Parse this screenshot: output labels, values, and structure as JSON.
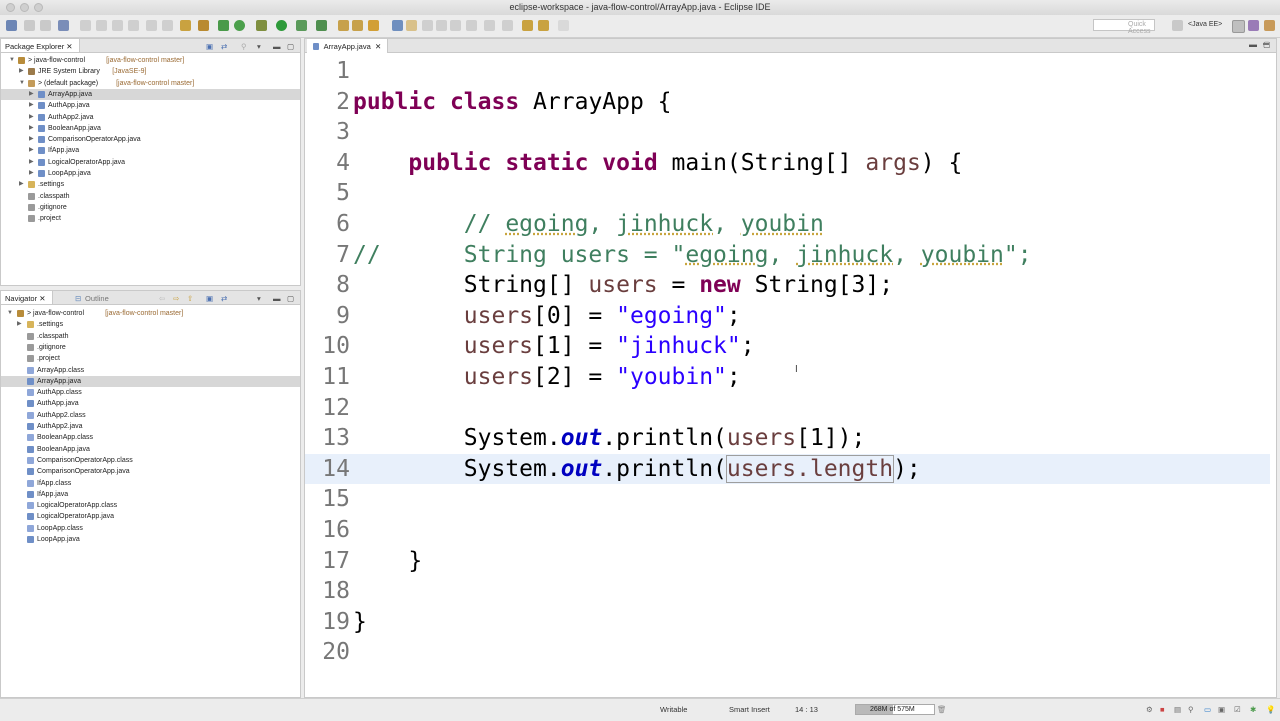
{
  "window": {
    "title": "eclipse-workspace - java-flow-control/ArrayApp.java - Eclipse IDE"
  },
  "toolbar": {
    "quick_access_placeholder": "Quick Access",
    "perspective": "<Java EE>"
  },
  "package_explorer": {
    "tab_label": "Package Explorer",
    "items": [
      {
        "label": "> java-flow-control",
        "decoration": "[java-flow-control master]",
        "icon": "project-icon"
      },
      {
        "label": "JRE System Library",
        "decoration": "[JavaSE-9]",
        "icon": "library-icon"
      },
      {
        "label": "> (default package)",
        "decoration": "[java-flow-control master]",
        "icon": "package-icon"
      },
      {
        "label": "ArrayApp.java",
        "decoration": "",
        "icon": "java-file-icon"
      },
      {
        "label": "AuthApp.java",
        "decoration": "",
        "icon": "java-file-icon"
      },
      {
        "label": "AuthApp2.java",
        "decoration": "",
        "icon": "java-file-icon"
      },
      {
        "label": "BooleanApp.java",
        "decoration": "",
        "icon": "java-file-icon"
      },
      {
        "label": "ComparisonOperatorApp.java",
        "decoration": "",
        "icon": "java-file-icon"
      },
      {
        "label": "IfApp.java",
        "decoration": "",
        "icon": "java-file-icon"
      },
      {
        "label": "LogicalOperatorApp.java",
        "decoration": "",
        "icon": "java-file-icon"
      },
      {
        "label": "LoopApp.java",
        "decoration": "",
        "icon": "java-file-icon"
      },
      {
        "label": ".settings",
        "decoration": "",
        "icon": "folder-icon"
      },
      {
        "label": ".classpath",
        "decoration": "",
        "icon": "file-icon"
      },
      {
        "label": ".gitignore",
        "decoration": "",
        "icon": "file-icon"
      },
      {
        "label": ".project",
        "decoration": "",
        "icon": "file-icon"
      }
    ]
  },
  "navigator": {
    "tab_label": "Navigator",
    "outline_label": "Outline",
    "items": [
      {
        "label": "> java-flow-control",
        "decoration": "[java-flow-control master]"
      },
      {
        "label": ".settings",
        "decoration": ""
      },
      {
        "label": ".classpath",
        "decoration": ""
      },
      {
        "label": ".gitignore",
        "decoration": ""
      },
      {
        "label": ".project",
        "decoration": ""
      },
      {
        "label": "ArrayApp.class",
        "decoration": ""
      },
      {
        "label": "ArrayApp.java",
        "decoration": ""
      },
      {
        "label": "AuthApp.class",
        "decoration": ""
      },
      {
        "label": "AuthApp.java",
        "decoration": ""
      },
      {
        "label": "AuthApp2.class",
        "decoration": ""
      },
      {
        "label": "AuthApp2.java",
        "decoration": ""
      },
      {
        "label": "BooleanApp.class",
        "decoration": ""
      },
      {
        "label": "BooleanApp.java",
        "decoration": ""
      },
      {
        "label": "ComparisonOperatorApp.class",
        "decoration": ""
      },
      {
        "label": "ComparisonOperatorApp.java",
        "decoration": ""
      },
      {
        "label": "IfApp.class",
        "decoration": ""
      },
      {
        "label": "IfApp.java",
        "decoration": ""
      },
      {
        "label": "LogicalOperatorApp.class",
        "decoration": ""
      },
      {
        "label": "LogicalOperatorApp.java",
        "decoration": ""
      },
      {
        "label": "LoopApp.class",
        "decoration": ""
      },
      {
        "label": "LoopApp.java",
        "decoration": ""
      }
    ]
  },
  "editor": {
    "tab_label": "ArrayApp.java",
    "lines": [
      {
        "n": "1",
        "tokens": []
      },
      {
        "n": "2",
        "tokens": [
          {
            "t": "public",
            "c": "kw"
          },
          {
            "t": " "
          },
          {
            "t": "class",
            "c": "kw"
          },
          {
            "t": " ArrayApp {"
          }
        ]
      },
      {
        "n": "3",
        "tokens": []
      },
      {
        "n": "4",
        "tokens": [
          {
            "t": "    "
          },
          {
            "t": "public",
            "c": "kw"
          },
          {
            "t": " "
          },
          {
            "t": "static",
            "c": "kw"
          },
          {
            "t": " "
          },
          {
            "t": "void",
            "c": "kw"
          },
          {
            "t": " main(String[] "
          },
          {
            "t": "args",
            "c": "var"
          },
          {
            "t": ") {"
          }
        ]
      },
      {
        "n": "5",
        "tokens": []
      },
      {
        "n": "6",
        "tokens": [
          {
            "t": "        "
          },
          {
            "t": "// ",
            "c": "cm"
          },
          {
            "t": "egoing",
            "c": "cm sq"
          },
          {
            "t": ", ",
            "c": "cm"
          },
          {
            "t": "jinhuck",
            "c": "cm sq"
          },
          {
            "t": ", ",
            "c": "cm"
          },
          {
            "t": "youbin",
            "c": "cm sq"
          }
        ]
      },
      {
        "n": "7",
        "tokens": [
          {
            "t": "//      String users = \"",
            "c": "cm"
          },
          {
            "t": "egoing",
            "c": "cm sq"
          },
          {
            "t": ", ",
            "c": "cm"
          },
          {
            "t": "jinhuck",
            "c": "cm sq"
          },
          {
            "t": ", ",
            "c": "cm"
          },
          {
            "t": "youbin",
            "c": "cm sq"
          },
          {
            "t": "\";",
            "c": "cm"
          }
        ]
      },
      {
        "n": "8",
        "tokens": [
          {
            "t": "        String[] "
          },
          {
            "t": "users",
            "c": "var"
          },
          {
            "t": " = "
          },
          {
            "t": "new",
            "c": "kw"
          },
          {
            "t": " String[3];"
          }
        ]
      },
      {
        "n": "9",
        "tokens": [
          {
            "t": "        "
          },
          {
            "t": "users",
            "c": "var"
          },
          {
            "t": "[0] = "
          },
          {
            "t": "\"egoing\"",
            "c": "st"
          },
          {
            "t": ";"
          }
        ]
      },
      {
        "n": "10",
        "tokens": [
          {
            "t": "        "
          },
          {
            "t": "users",
            "c": "var"
          },
          {
            "t": "[1] = "
          },
          {
            "t": "\"jinhuck\"",
            "c": "st"
          },
          {
            "t": ";"
          }
        ]
      },
      {
        "n": "11",
        "tokens": [
          {
            "t": "        "
          },
          {
            "t": "users",
            "c": "var"
          },
          {
            "t": "[2] = "
          },
          {
            "t": "\"youbin\"",
            "c": "st"
          },
          {
            "t": ";"
          }
        ]
      },
      {
        "n": "12",
        "tokens": []
      },
      {
        "n": "13",
        "tokens": [
          {
            "t": "        System."
          },
          {
            "t": "out",
            "c": "fld"
          },
          {
            "t": ".println("
          },
          {
            "t": "users",
            "c": "var"
          },
          {
            "t": "[1]);"
          }
        ]
      },
      {
        "n": "14",
        "tokens": [
          {
            "t": "        System."
          },
          {
            "t": "out",
            "c": "fld"
          },
          {
            "t": ".println("
          },
          {
            "t": "users.length",
            "c": "var box"
          },
          {
            "t": ");"
          }
        ],
        "current": true
      },
      {
        "n": "15",
        "tokens": []
      },
      {
        "n": "16",
        "tokens": []
      },
      {
        "n": "17",
        "tokens": [
          {
            "t": "    }"
          }
        ]
      },
      {
        "n": "18",
        "tokens": []
      },
      {
        "n": "19",
        "tokens": [
          {
            "t": "}"
          }
        ]
      },
      {
        "n": "20",
        "tokens": []
      }
    ]
  },
  "status": {
    "writable": "Writable",
    "insert_mode": "Smart Insert",
    "position": "14 : 13",
    "heap": "268M of 575M",
    "heap_used_fraction": 0.47
  }
}
